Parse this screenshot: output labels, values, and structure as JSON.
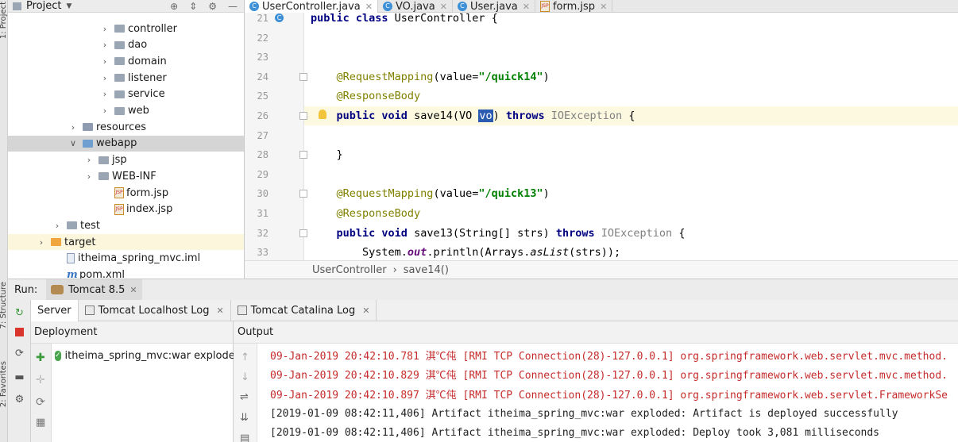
{
  "tool_strip": {
    "project_label": "1: Project",
    "structure_label": "7: Structure",
    "favorites_label": "2: Favorites"
  },
  "project": {
    "title": "Project",
    "tree": [
      {
        "label": "controller",
        "kind": "folder",
        "depth": 6,
        "expanded": false
      },
      {
        "label": "dao",
        "kind": "folder",
        "depth": 6,
        "expanded": false
      },
      {
        "label": "domain",
        "kind": "folder",
        "depth": 6,
        "expanded": false
      },
      {
        "label": "listener",
        "kind": "folder",
        "depth": 6,
        "expanded": false
      },
      {
        "label": "service",
        "kind": "folder",
        "depth": 6,
        "expanded": false
      },
      {
        "label": "web",
        "kind": "folder",
        "depth": 6,
        "expanded": false
      },
      {
        "label": "resources",
        "kind": "resources",
        "depth": 4,
        "expanded": false
      },
      {
        "label": "webapp",
        "kind": "webfolder",
        "depth": 4,
        "expanded": true,
        "selected": true
      },
      {
        "label": "jsp",
        "kind": "folder",
        "depth": 5,
        "expanded": false
      },
      {
        "label": "WEB-INF",
        "kind": "folder",
        "depth": 5,
        "expanded": false
      },
      {
        "label": "form.jsp",
        "kind": "jsp",
        "depth": 6
      },
      {
        "label": "index.jsp",
        "kind": "jsp",
        "depth": 6
      },
      {
        "label": "test",
        "kind": "folder",
        "depth": 3,
        "expanded": false
      },
      {
        "label": "target",
        "kind": "orange",
        "depth": 2,
        "expanded": false,
        "highlight": true
      },
      {
        "label": "itheima_spring_mvc.iml",
        "kind": "iml",
        "depth": 3
      },
      {
        "label": "pom.xml",
        "kind": "maven",
        "depth": 3
      }
    ]
  },
  "editor": {
    "tabs": [
      {
        "label": "UserController.java",
        "icon": "C",
        "active": true
      },
      {
        "label": "VO.java",
        "icon": "C",
        "active": false
      },
      {
        "label": "User.java",
        "icon": "C",
        "active": false
      },
      {
        "label": "form.jsp",
        "icon": "JSP",
        "active": false
      }
    ],
    "lines": [
      {
        "n": "21",
        "code": [
          [
            "kw",
            "public class "
          ],
          [
            "",
            "UserController {"
          ]
        ],
        "partial": true
      },
      {
        "n": "22",
        "code": []
      },
      {
        "n": "23",
        "code": []
      },
      {
        "n": "24",
        "code": [
          [
            "",
            "    "
          ],
          [
            "ann",
            "@RequestMapping"
          ],
          [
            "",
            "(value="
          ],
          [
            "str",
            "\"/quick14\""
          ],
          [
            "",
            ")"
          ]
        ],
        "fold": true
      },
      {
        "n": "25",
        "code": [
          [
            "",
            "    "
          ],
          [
            "ann",
            "@ResponseBody"
          ]
        ]
      },
      {
        "n": "26",
        "code": [
          [
            "",
            "    "
          ],
          [
            "kw",
            "public void "
          ],
          [
            "",
            "save14(VO "
          ],
          [
            "sel",
            "vo"
          ],
          [
            "",
            ") "
          ],
          [
            "kw",
            "throws "
          ],
          [
            "cls",
            "IOException"
          ],
          [
            "",
            " {"
          ]
        ],
        "fold": true,
        "current": true,
        "bulb": true
      },
      {
        "n": "27",
        "code": []
      },
      {
        "n": "28",
        "code": [
          [
            "",
            "    }"
          ]
        ],
        "fold": true
      },
      {
        "n": "29",
        "code": []
      },
      {
        "n": "30",
        "code": [
          [
            "",
            "    "
          ],
          [
            "ann",
            "@RequestMapping"
          ],
          [
            "",
            "(value="
          ],
          [
            "str",
            "\"/quick13\""
          ],
          [
            "",
            ")"
          ]
        ],
        "fold": true
      },
      {
        "n": "31",
        "code": [
          [
            "",
            "    "
          ],
          [
            "ann",
            "@ResponseBody"
          ]
        ]
      },
      {
        "n": "32",
        "code": [
          [
            "",
            "    "
          ],
          [
            "kw",
            "public void "
          ],
          [
            "",
            "save13(String[] strs) "
          ],
          [
            "kw",
            "throws "
          ],
          [
            "cls",
            "IOException"
          ],
          [
            "",
            " {"
          ]
        ],
        "fold": true
      },
      {
        "n": "33",
        "code": [
          [
            "",
            "        System."
          ],
          [
            "fld",
            "out"
          ],
          [
            "",
            ".println(Arrays."
          ],
          [
            "italic",
            "asList"
          ],
          [
            "",
            "(strs));"
          ]
        ]
      }
    ],
    "breadcrumb": [
      "UserController",
      "save14()"
    ]
  },
  "run": {
    "label": "Run:",
    "config_tab": "Tomcat 8.5",
    "subtabs": [
      {
        "label": "Server",
        "active": true,
        "closable": false
      },
      {
        "label": "Tomcat Localhost Log",
        "active": false,
        "closable": true
      },
      {
        "label": "Tomcat Catalina Log",
        "active": false,
        "closable": true
      }
    ],
    "deployment_header": "Deployment",
    "deployment_item": "itheima_spring_mvc:war exploded",
    "output_header": "Output",
    "output_lines": [
      {
        "text": "09-Jan-2019 20:42:10.781 淇℃伅 [RMI TCP Connection(28)-127.0.0.1] org.springframework.web.servlet.mvc.method.",
        "color": "red"
      },
      {
        "text": "09-Jan-2019 20:42:10.829 淇℃伅 [RMI TCP Connection(28)-127.0.0.1] org.springframework.web.servlet.mvc.method.",
        "color": "red"
      },
      {
        "text": "09-Jan-2019 20:42:10.897 淇℃伅 [RMI TCP Connection(28)-127.0.0.1] org.springframework.web.servlet.FrameworkSe",
        "color": "red"
      },
      {
        "text": "[2019-01-09 08:42:11,406] Artifact itheima_spring_mvc:war exploded: Artifact is deployed successfully",
        "color": "black"
      },
      {
        "text": "[2019-01-09 08:42:11,406] Artifact itheima_spring_mvc:war exploded: Deploy took 3,081 milliseconds",
        "color": "black"
      }
    ]
  },
  "colors": {
    "keyword": "#000080",
    "annotation": "#808000",
    "string": "#008000",
    "error_log": "#c52b2b",
    "selection": "#2b5bb0"
  }
}
